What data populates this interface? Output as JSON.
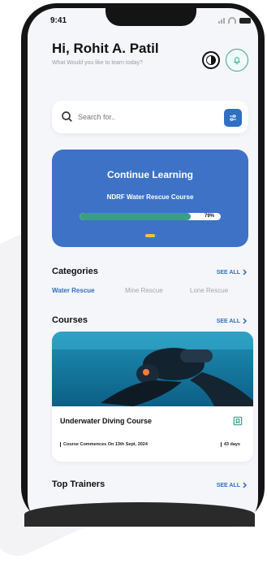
{
  "status_bar": {
    "time": "9:41"
  },
  "header": {
    "greeting": "Hi, Rohit A. Patil",
    "subtitle": "What Would you like to learn today?"
  },
  "search": {
    "placeholder": "Search for.."
  },
  "continue_card": {
    "title": "Continue Learning",
    "course": "NDRF Water Rescue Course",
    "progress_label": "79%",
    "progress": 0.79
  },
  "categories": {
    "title": "Categories",
    "see_all": "SEE ALL",
    "items": [
      "Water Rescue",
      "Mine Rescue",
      "Lone Rescue"
    ]
  },
  "courses": {
    "title": "Courses",
    "see_all": "SEE ALL",
    "card": {
      "title": "Underwater Diving Course",
      "commence": "Course Commences On 13th Sept, 2024",
      "duration": "43 days"
    }
  },
  "trainers": {
    "title": "Top Trainers",
    "see_all": "SEE ALL"
  },
  "colors": {
    "accent": "#2f6fc4",
    "hero": "#3d72c7",
    "progress": "#3a9e86",
    "highlight": "#f3c244"
  }
}
